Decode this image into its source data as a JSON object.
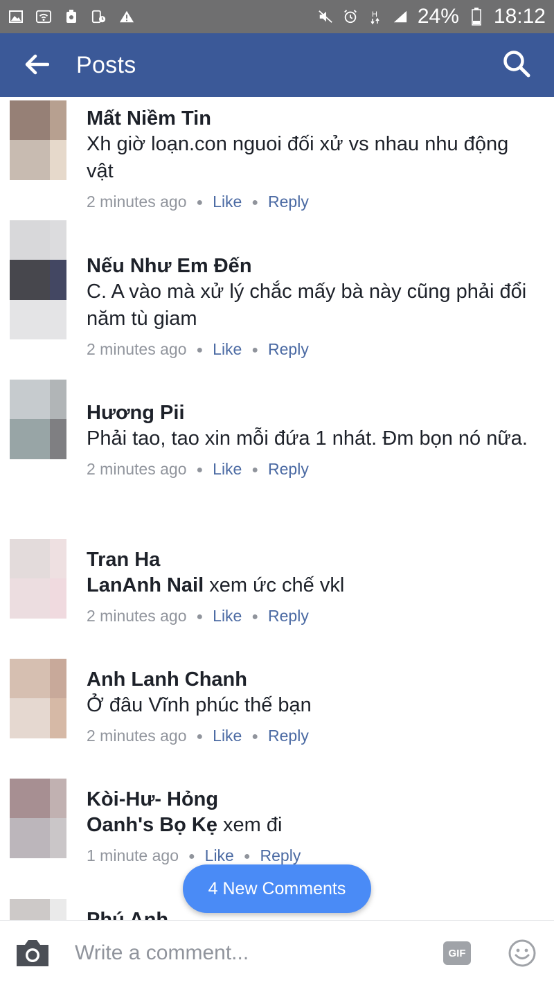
{
  "status_bar": {
    "battery_percent": "24%",
    "time": "18:12",
    "left_icons": [
      "gallery-icon",
      "wifi-icon",
      "clean-icon",
      "device-icon",
      "warning-icon"
    ],
    "right_icons": [
      "mute-icon",
      "alarm-icon",
      "network-h-icon",
      "signal-icon",
      "battery-icon"
    ]
  },
  "app_bar": {
    "title": "Posts",
    "back_icon": "back-arrow-icon",
    "search_icon": "search-icon",
    "bg_color": "#3b5998"
  },
  "comments": [
    {
      "author": "Mất Niềm Tin",
      "mention": "",
      "text": "Xh giờ loạn.con nguoi đối xử vs nhau nhu động vật",
      "time": "2 minutes ago",
      "like": "Like",
      "reply": "Reply",
      "avatar_colors": [
        "#968076",
        "#b7a090",
        "#c8bbb1",
        "#e6d9cb"
      ]
    },
    {
      "author": "Nếu Như Em Đến",
      "mention": "",
      "text": "C. A vào mà xử lý chắc mấy bà này cũng phải đổi năm tù giam",
      "time": "2 minutes ago",
      "like": "Like",
      "reply": "Reply",
      "avatar_colors": [
        "#d8d8da",
        "#dcdcde",
        "#47474d",
        "#434762",
        "#e4e4e6"
      ]
    },
    {
      "author": "Hương Pii",
      "mention": "",
      "text": "Phải tao, tao xin mỗi đứa 1 nhát. Đm bọn nó nữa.",
      "time": "2 minutes ago",
      "like": "Like",
      "reply": "Reply",
      "avatar_colors": [
        "#c6cbce",
        "#b1b5b7",
        "#98a5a6",
        "#7f7f82"
      ]
    },
    {
      "author": "Tran Ha",
      "mention": "LanAnh Nail",
      "text": "xem ức chế vkl",
      "time": "2 minutes ago",
      "like": "Like",
      "reply": "Reply",
      "avatar_colors": [
        "#e3dbdb",
        "#eee0e1",
        "#ecdde0",
        "#f0dadf"
      ]
    },
    {
      "author": "Anh Lanh Chanh",
      "mention": "",
      "text": "Ở đâu Vĩnh phúc thế bạn",
      "time": "2 minutes ago",
      "like": "Like",
      "reply": "Reply",
      "avatar_colors": [
        "#d6bfb1",
        "#c8a99a",
        "#e5d8d0",
        "#d6b9a6"
      ]
    },
    {
      "author": "Kòi-Hư- Hỏng",
      "mention": "Oanh's Bọ Kẹ",
      "text": "xem đi",
      "time": "1 minute ago",
      "like": "Like",
      "reply": "Reply",
      "avatar_colors": [
        "#a78f92",
        "#c1b1b1",
        "#bcb6bb",
        "#cac6c8"
      ]
    },
    {
      "author": "Phú Anh",
      "mention": "",
      "text": "",
      "time": "",
      "like": "",
      "reply": "",
      "avatar_colors": [
        "#cdc9c8",
        "#eaeaea",
        "#e4e4e4",
        "#f2f2f2"
      ]
    }
  ],
  "new_comments_button": "4 New Comments",
  "composer": {
    "placeholder": "Write a comment...",
    "gif_label": "GIF",
    "camera_icon": "camera-icon",
    "emoji_icon": "smiley-icon"
  }
}
